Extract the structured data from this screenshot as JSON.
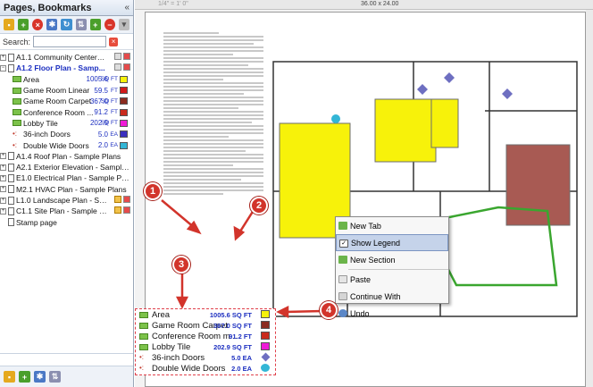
{
  "panel": {
    "title": "Pages, Bookmarks",
    "collapse": "«",
    "search_label": "Search:",
    "search_value": "",
    "tree": [
      {
        "label": "A1.1 Community Center - Sam...",
        "kind": "page",
        "expand": "+"
      },
      {
        "label": "A1.2 Floor Plan - Samp...",
        "kind": "page",
        "expand": "−",
        "selected": true
      },
      {
        "label": "Area",
        "kind": "leaf",
        "value": "1005.6",
        "unit": "SQ FT",
        "swatch": "#f7f20a"
      },
      {
        "label": "Game Room Linear",
        "kind": "leaf",
        "value": "59.5",
        "unit": "FT",
        "swatch": "#d11a1a"
      },
      {
        "label": "Game Room Carpet",
        "kind": "leaf",
        "value": "367.0",
        "unit": "SQ FT",
        "swatch": "#8b2c20"
      },
      {
        "label": "Conference Room ...",
        "kind": "leaf",
        "value": "91.2",
        "unit": "FT",
        "swatch": "#c92a1d"
      },
      {
        "label": "Lobby Tile",
        "kind": "leaf",
        "value": "202.9",
        "unit": "SQ FT",
        "swatch": "#ef1bd7"
      },
      {
        "label": "36-inch Doors",
        "kind": "count",
        "value": "5.0",
        "unit": "EA",
        "swatch": "#3b2fbf"
      },
      {
        "label": "Double Wide Doors",
        "kind": "count",
        "value": "2.0",
        "unit": "EA",
        "swatch": "#33b6d6"
      },
      {
        "label": "A1.4 Roof Plan - Sample Plans",
        "kind": "page",
        "expand": "+"
      },
      {
        "label": "A2.1 Exterior Elevation - Sample Plans",
        "kind": "page",
        "expand": "+"
      },
      {
        "label": "E1.0 Electrical Plan - Sample Plans",
        "kind": "page",
        "expand": "+"
      },
      {
        "label": "M2.1 HVAC Plan - Sample Plans",
        "kind": "page",
        "expand": "+"
      },
      {
        "label": "L1.0 Landscape Plan - Sample ...",
        "kind": "page",
        "expand": "+"
      },
      {
        "label": "C1.1 Site Plan - Sample Plans",
        "kind": "page",
        "expand": "+"
      },
      {
        "label": "Stamp page",
        "kind": "page",
        "expand": ""
      }
    ]
  },
  "canvas": {
    "ruler_scale": "1/4\" = 1' 0\"",
    "ruler_size": "36.00 x 24.00"
  },
  "context_menu": {
    "items": [
      "New Tab",
      "Show Legend",
      "New Section",
      "Paste",
      "Continue With",
      "Undo"
    ],
    "highlighted": "Show Legend"
  },
  "legend": {
    "rows": [
      {
        "label": "Area",
        "value": "1005.6 SQ FT",
        "color": "#f7f20a",
        "icon": "leaf"
      },
      {
        "label": "Game Room Carpet",
        "value": "367.0 SQ FT",
        "color": "#8b2c20",
        "icon": "leaf"
      },
      {
        "label": "Conference Room m...",
        "value": "91.2 FT",
        "color": "#c92a1d",
        "icon": "leaf"
      },
      {
        "label": "Lobby Tile",
        "value": "202.9 SQ FT",
        "color": "#ef1bd7",
        "icon": "leaf"
      },
      {
        "label": "36-inch Doors",
        "value": "5.0 EA",
        "color": "#6e6fc1",
        "icon": "dots"
      },
      {
        "label": "Double Wide Doors",
        "value": "2.0 EA",
        "color": "#33b6d6",
        "icon": "dots"
      }
    ]
  },
  "callouts": [
    "1",
    "2",
    "3",
    "4"
  ],
  "colors": {
    "area_yellow": "#f7f20a",
    "carpet_brown": "#a85a53",
    "lobby_magenta": "#ef1bd7",
    "green_outline": "#3aa62f",
    "door_blue": "#6e6fc1",
    "callout_red": "#d2342b"
  }
}
